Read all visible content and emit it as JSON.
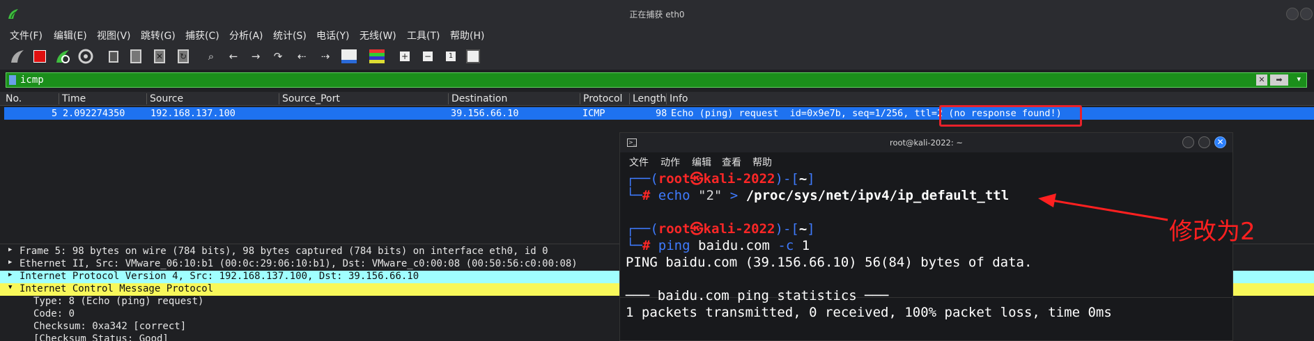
{
  "wireshark": {
    "title": "正在捕获 eth0",
    "menu": [
      "文件(F)",
      "编辑(E)",
      "视图(V)",
      "跳转(G)",
      "捕获(C)",
      "分析(A)",
      "统计(S)",
      "电话(Y)",
      "无线(W)",
      "工具(T)",
      "帮助(H)"
    ],
    "toolbar_icons": [
      "shark-fin-start-icon",
      "stop-capture-icon",
      "restart-capture-icon",
      "capture-options-icon",
      "open-file-icon",
      "save-file-icon",
      "close-file-icon",
      "reload-icon",
      "find-packet-icon",
      "go-back-icon",
      "go-forward-icon",
      "go-to-packet-icon",
      "go-first-icon",
      "go-last-icon",
      "auto-scroll-icon",
      "colorize-icon",
      "zoom-in-icon",
      "zoom-out-icon",
      "normal-size-icon",
      "resize-columns-icon"
    ],
    "filter": {
      "value": "icmp"
    },
    "columns": [
      "No.",
      "Time",
      "Source",
      "Source_Port",
      "Destination",
      "Protocol",
      "Length",
      "Info"
    ],
    "packets": [
      {
        "no": "5",
        "time": "2.092274350",
        "source": "192.168.137.100",
        "source_port": "",
        "destination": "39.156.66.10",
        "protocol": "ICMP",
        "length": "98",
        "info": "Echo (ping) request  id=0x9e7b, seq=1/256, ttl=2 (no response found!)"
      }
    ],
    "details": [
      {
        "text": "Frame 5: 98 bytes on wire (784 bits), 98 bytes captured (784 bits) on interface eth0, id 0",
        "expanded": false
      },
      {
        "text": "Ethernet II, Src: VMware_06:10:b1 (00:0c:29:06:10:b1), Dst: VMware_c0:00:08 (00:50:56:c0:00:08)",
        "expanded": false
      },
      {
        "text": "Internet Protocol Version 4, Src: 192.168.137.100, Dst: 39.156.66.10",
        "expanded": false
      },
      {
        "text": "Internet Control Message Protocol",
        "expanded": true
      }
    ],
    "icmp_fields": [
      "Type: 8 (Echo (ping) request)",
      "Code: 0",
      "Checksum: 0xa342 [correct]",
      "[Checksum Status: Good]"
    ],
    "colors": {
      "selected_row": "#1e72f0",
      "ipv4_row": "#a0ffff",
      "icmp_row": "#f8f85a",
      "filter_bg": "#1b8f1b"
    }
  },
  "terminal": {
    "title": "root@kali-2022: ~",
    "menu": [
      "文件",
      "动作",
      "编辑",
      "查看",
      "帮助"
    ],
    "prompt": {
      "open": "┌──(",
      "user": "root",
      "at": "㉿",
      "host": "kali-2022",
      "mid": ")-[",
      "dir": "~",
      "close": "]",
      "hash_prefix": "└─",
      "hash": "#"
    },
    "cmd1": {
      "program": "echo",
      "arg": "\"2\"",
      "redirect": ">",
      "path": "/proc/sys/net/ipv4/ip_default_ttl"
    },
    "cmd2": {
      "program": "ping",
      "arg": "baidu.com",
      "flag": "-c",
      "value": "1"
    },
    "output": [
      "PING baidu.com (39.156.66.10) 56(84) bytes of data.",
      "",
      "─── baidu.com ping statistics ───",
      "1 packets transmitted, 0 received, 100% packet loss, time 0ms"
    ]
  },
  "annotation": {
    "text": "修改为2",
    "color": "#ff2020"
  }
}
